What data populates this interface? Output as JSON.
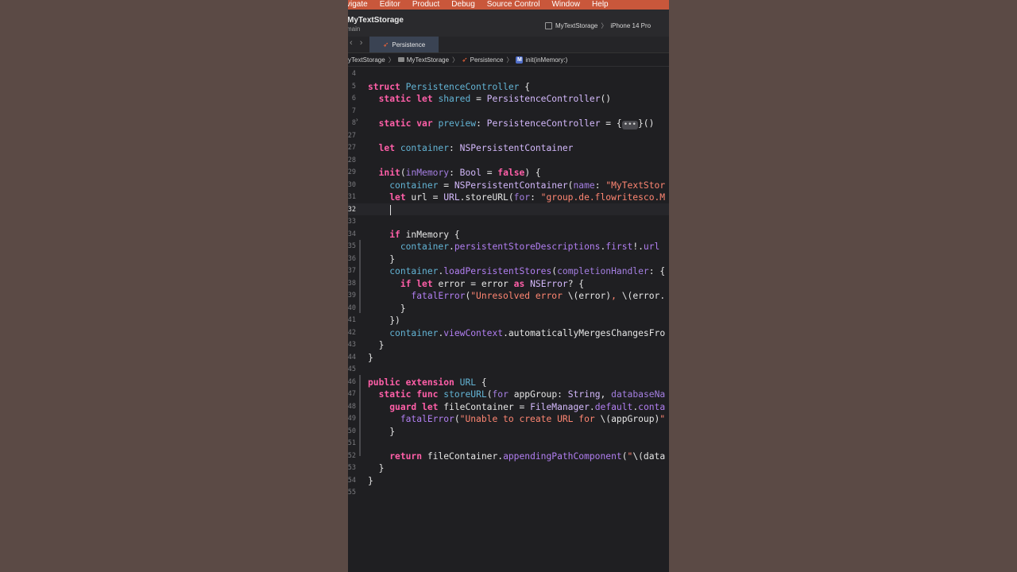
{
  "menubar": {
    "items": [
      "vigate",
      "Editor",
      "Product",
      "Debug",
      "Source Control",
      "Window",
      "Help"
    ]
  },
  "titlebar": {
    "project": "MyTextStorage",
    "branch": "main",
    "scheme": "MyTextStorage",
    "device": "iPhone 14 Pro"
  },
  "tabbar": {
    "back": "‹",
    "forward": "›",
    "active_tab": "Persistence"
  },
  "jumpbar": {
    "items": [
      "yTextStorage",
      "MyTextStorage",
      "Persistence",
      "init(inMemory:)"
    ],
    "method_icon": "M"
  },
  "editor": {
    "lines": [
      {
        "n": "4",
        "html": ""
      },
      {
        "n": "5",
        "html": "<span class=\"kw\">struct</span> <span class=\"cls\">PersistenceController</span> {"
      },
      {
        "n": "6",
        "html": "  <span class=\"kw\">static</span> <span class=\"kw\">let</span> <span class=\"cls\">shared</span> = <span class=\"ty\">PersistenceController</span>()"
      },
      {
        "n": "7",
        "html": ""
      },
      {
        "n": "8",
        "html": "  <span class=\"kw\">static</span> <span class=\"kw\">var</span> <span class=\"cls\">preview</span>: <span class=\"ty\">PersistenceController</span> = {<span class=\"fold\">•••</span>}()"
      },
      {
        "n": "27",
        "html": ""
      },
      {
        "n": "27",
        "html": "  <span class=\"kw\">let</span> <span class=\"cls\">container</span>: <span class=\"ty\">NSPersistentContainer</span>"
      },
      {
        "n": "28",
        "html": ""
      },
      {
        "n": "29",
        "html": "  <span class=\"kw\">init</span>(<span class=\"prm\">inMemory</span>: <span class=\"ty\">Bool</span> = <span class=\"kw\">false</span>) {"
      },
      {
        "n": "30",
        "html": "    <span class=\"cls\">container</span> = <span class=\"ty\">NSPersistentContainer</span>(<span class=\"prm\">name</span>: <span class=\"str\">\"MyTextStor</span>"
      },
      {
        "n": "31",
        "html": "    <span class=\"kw\">let</span> url = <span class=\"ty\">URL</span>.storeURL(<span class=\"prm\">for</span>: <span class=\"str\">\"group.de.flowritesco.M</span>"
      },
      {
        "n": "32",
        "html": ""
      },
      {
        "n": "33",
        "html": ""
      },
      {
        "n": "34",
        "html": "    <span class=\"kw\">if</span> inMemory {"
      },
      {
        "n": "35",
        "html": "      <span class=\"cls\">container</span>.<span class=\"fn\">persistentStoreDescriptions</span>.<span class=\"fn\">first</span>!.<span class=\"fn\">url</span>"
      },
      {
        "n": "36",
        "html": "    }"
      },
      {
        "n": "37",
        "html": "    <span class=\"cls\">container</span>.<span class=\"fn\">loadPersistentStores</span>(<span class=\"prm\">completionHandler</span>: {"
      },
      {
        "n": "38",
        "html": "      <span class=\"kw\">if</span> <span class=\"kw\">let</span> error = error <span class=\"kw\">as</span> <span class=\"ty\">NSError</span>? {"
      },
      {
        "n": "39",
        "html": "        <span class=\"fn\">fatalError</span>(<span class=\"str\">\"Unresolved error </span>\\(error)<span class=\"str\">, </span>\\(error."
      },
      {
        "n": "40",
        "html": "      }"
      },
      {
        "n": "41",
        "html": "    })"
      },
      {
        "n": "42",
        "html": "    <span class=\"cls\">container</span>.<span class=\"fn\">viewContext</span>.automaticallyMergesChangesFro"
      },
      {
        "n": "43",
        "html": "  }"
      },
      {
        "n": "44",
        "html": "}"
      },
      {
        "n": "45",
        "html": ""
      },
      {
        "n": "46",
        "html": "<span class=\"kw\">public</span> <span class=\"kw\">extension</span> <span class=\"cls\">URL</span> {"
      },
      {
        "n": "47",
        "html": "  <span class=\"kw\">static</span> <span class=\"kw\">func</span> <span class=\"cls\">storeURL</span>(<span class=\"prm\">for</span> appGroup: <span class=\"ty\">String</span>, <span class=\"prm\">databaseNa</span>"
      },
      {
        "n": "48",
        "html": "    <span class=\"kw\">guard</span> <span class=\"kw\">let</span> fileContainer = <span class=\"ty\">FileManager</span>.<span class=\"fn\">default</span>.<span class=\"fn\">conta</span>"
      },
      {
        "n": "49",
        "html": "      <span class=\"fn\">fatalError</span>(<span class=\"str\">\"Unable to create URL for </span>\\(appGroup)<span class=\"str\">\"</span>"
      },
      {
        "n": "50",
        "html": "    }"
      },
      {
        "n": "51",
        "html": ""
      },
      {
        "n": "52",
        "html": "    <span class=\"kw\">return</span> fileContainer.<span class=\"fn\">appendingPathComponent</span>(<span class=\"str\">\"</span>\\(data"
      },
      {
        "n": "53",
        "html": "  }"
      },
      {
        "n": "54",
        "html": "}"
      },
      {
        "n": "55",
        "html": ""
      }
    ]
  }
}
